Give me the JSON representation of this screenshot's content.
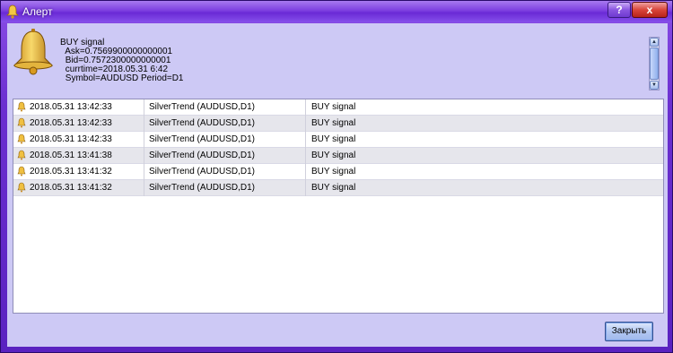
{
  "window": {
    "title": "Алерт",
    "help_label": "?",
    "close_label": "x"
  },
  "message": {
    "lines": [
      "BUY signal",
      " Ask=0.7569900000000001",
      " Bid=0.7572300000000001",
      " currtime=2018.05.31 6:42",
      " Symbol=AUDUSD Period=D1"
    ]
  },
  "alerts": [
    {
      "time": "2018.05.31 13:42:33",
      "source": "SilverTrend (AUDUSD,D1)",
      "message": "BUY signal"
    },
    {
      "time": "2018.05.31 13:42:33",
      "source": "SilverTrend (AUDUSD,D1)",
      "message": "BUY signal"
    },
    {
      "time": "2018.05.31 13:42:33",
      "source": "SilverTrend (AUDUSD,D1)",
      "message": "BUY signal"
    },
    {
      "time": "2018.05.31 13:41:38",
      "source": "SilverTrend (AUDUSD,D1)",
      "message": "BUY signal"
    },
    {
      "time": "2018.05.31 13:41:32",
      "source": "SilverTrend (AUDUSD,D1)",
      "message": "BUY signal"
    },
    {
      "time": "2018.05.31 13:41:32",
      "source": "SilverTrend (AUDUSD,D1)",
      "message": "BUY signal"
    }
  ],
  "footer": {
    "close_button": "Закрыть"
  },
  "icons": {
    "title": "bell-icon",
    "message": "bell-icon",
    "row": "bell-icon"
  },
  "colors": {
    "frame": "#6b2fd0",
    "client": "#cdc9f5",
    "alt_row": "#e6e6ec"
  }
}
